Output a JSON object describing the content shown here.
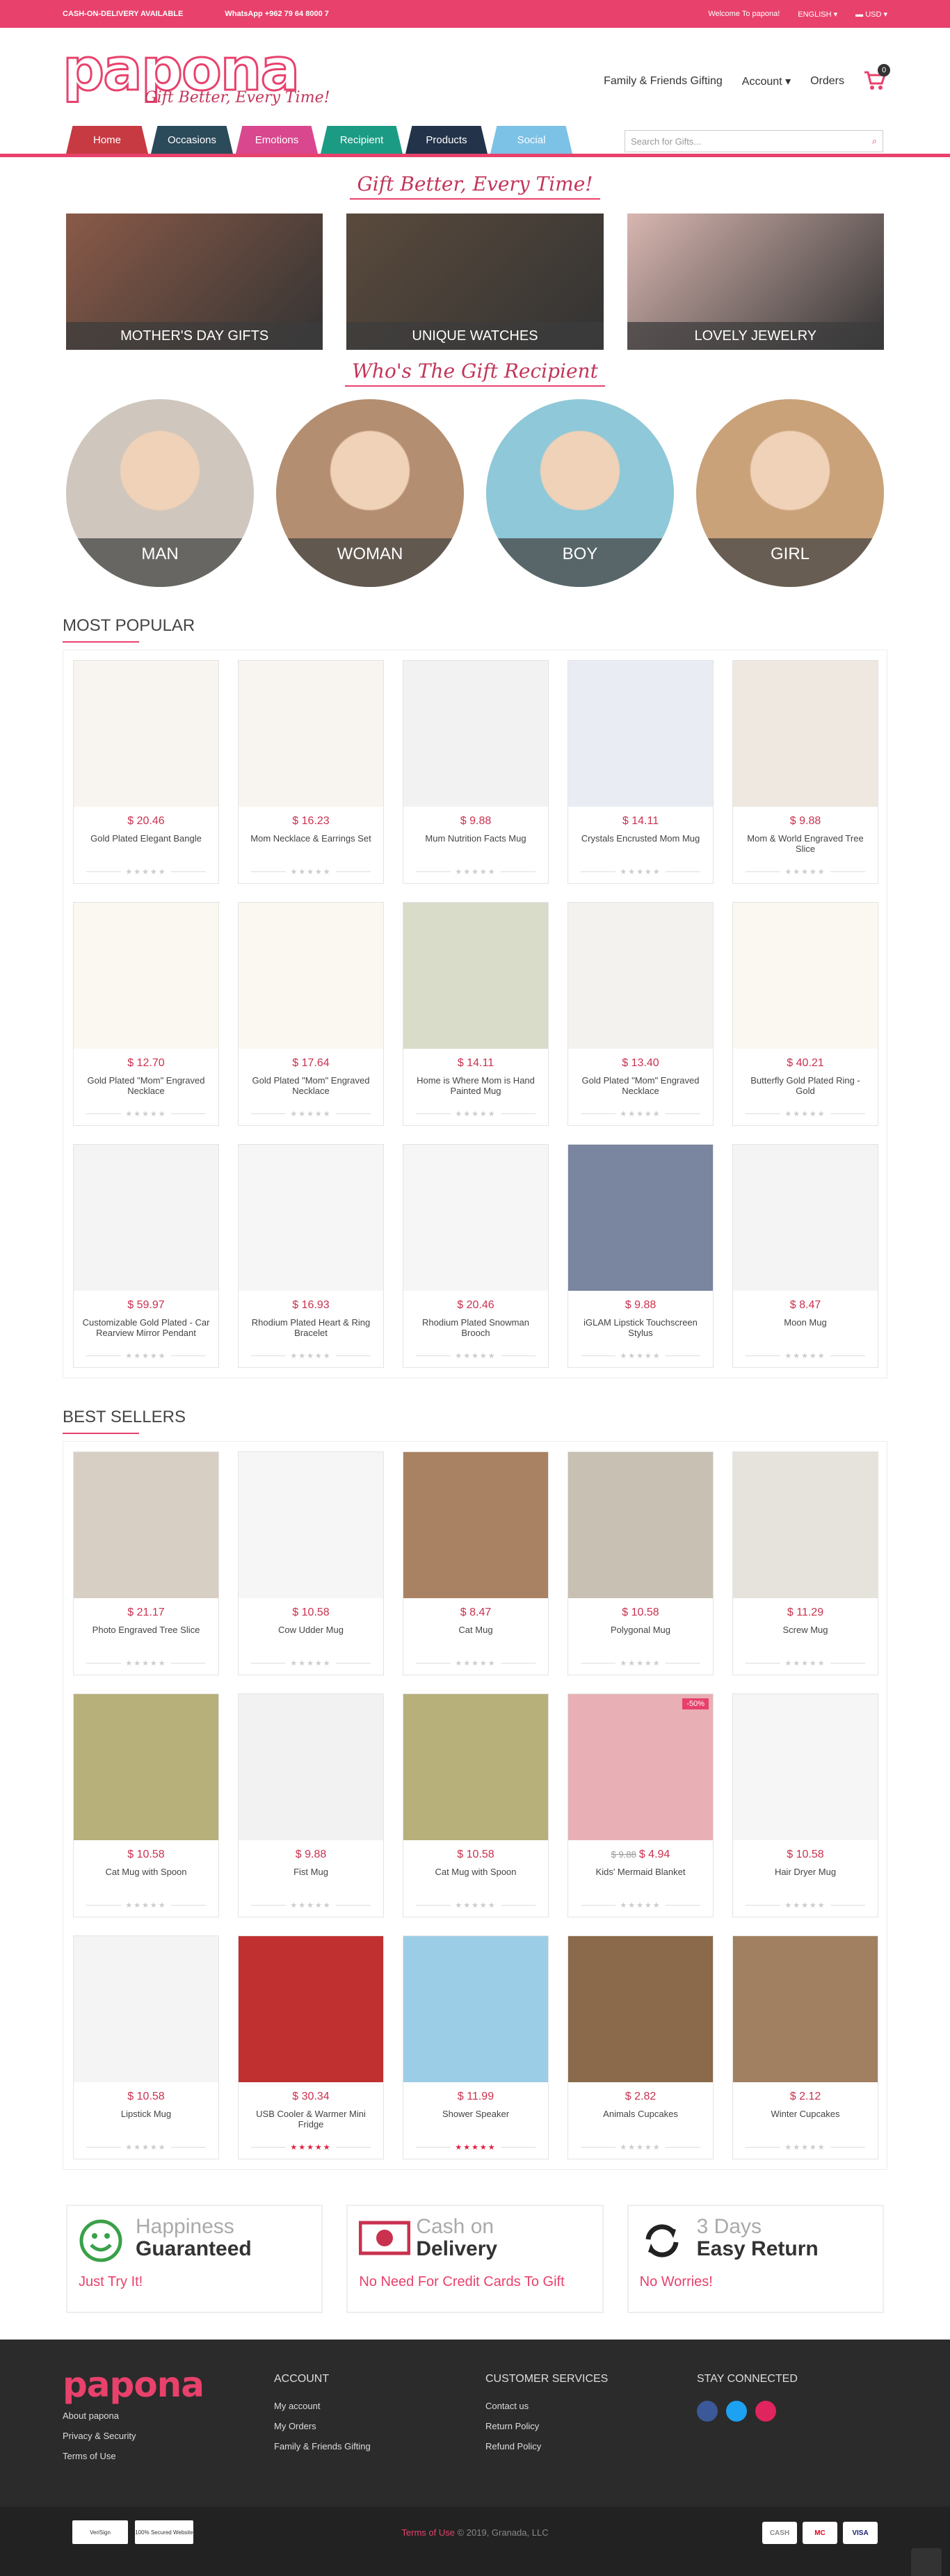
{
  "topbar": {
    "cod": "CASH-ON-DELIVERY AVAILABLE",
    "whatsapp": "WhatsApp +962 79 64 8000 7",
    "welcome": "Welcome To papona!",
    "language": "ENGLISH",
    "currency": "USD"
  },
  "header": {
    "logo": "papona",
    "tagline": "Gift Better, Every Time!",
    "nav": [
      "Family & Friends Gifting",
      "Account",
      "Orders"
    ],
    "cart_count": "0"
  },
  "tabs": [
    {
      "label": "Home",
      "color": "#c73a42"
    },
    {
      "label": "Occasions",
      "color": "#2b4a5a"
    },
    {
      "label": "Emotions",
      "color": "#d9478e"
    },
    {
      "label": "Recipient",
      "color": "#1c9b84"
    },
    {
      "label": "Products",
      "color": "#23334a"
    },
    {
      "label": "Social",
      "color": "#7cc1e6"
    }
  ],
  "search": {
    "placeholder": "Search for Gifts..."
  },
  "tagline1": "Gift Better, Every Time!",
  "banners": [
    {
      "label": "MOTHER'S DAY GIFTS",
      "bg": "#8a5a48"
    },
    {
      "label": "UNIQUE WATCHES",
      "bg": "#5a4a3c"
    },
    {
      "label": "LOVELY JEWELRY",
      "bg": "#d8b6b0"
    }
  ],
  "tagline2": "Who's The Gift Recipient",
  "recipients": [
    {
      "label": "MAN",
      "bg": "#cfc6bd"
    },
    {
      "label": "WOMAN",
      "bg": "#b48e70"
    },
    {
      "label": "BOY",
      "bg": "#8fc8d8"
    },
    {
      "label": "GIRL",
      "bg": "#c9a27a"
    }
  ],
  "popular": {
    "title": "MOST POPULAR",
    "items": [
      {
        "price": "$ 20.46",
        "name": "Gold Plated Elegant Bangle",
        "bg": "#f8f4ef"
      },
      {
        "price": "$ 16.23",
        "name": "Mom Necklace & Earrings Set",
        "bg": "#f8f4ef"
      },
      {
        "price": "$ 9.88",
        "name": "Mum Nutrition Facts Mug",
        "bg": "#f2f2f2"
      },
      {
        "price": "$ 14.11",
        "name": "Crystals Encrusted Mom Mug",
        "bg": "#e9edf3"
      },
      {
        "price": "$ 9.88",
        "name": "Mom & World Engraved Tree Slice",
        "bg": "#efe8e0"
      },
      {
        "price": "$ 12.70",
        "name": "Gold Plated \"Mom\" Engraved Necklace",
        "bg": "#fbf8f2"
      },
      {
        "price": "$ 17.64",
        "name": "Gold Plated \"Mom\" Engraved Necklace",
        "bg": "#fbf8f2"
      },
      {
        "price": "$ 14.11",
        "name": "Home is Where Mom is Hand Painted Mug",
        "bg": "#d9dcc8"
      },
      {
        "price": "$ 13.40",
        "name": "Gold Plated \"Mom\" Engraved Necklace",
        "bg": "#f4f2ee"
      },
      {
        "price": "$ 40.21",
        "name": "Butterfly Gold Plated Ring - Gold",
        "bg": "#fbf8f2"
      },
      {
        "price": "$ 59.97",
        "name": "Customizable Gold Plated - Car Rearview Mirror Pendant",
        "bg": "#f4f4f4"
      },
      {
        "price": "$ 16.93",
        "name": "Rhodium Plated Heart & Ring Bracelet",
        "bg": "#f6f6f6"
      },
      {
        "price": "$ 20.46",
        "name": "Rhodium Plated Snowman Brooch",
        "bg": "#f6f6f6"
      },
      {
        "price": "$ 9.88",
        "name": "iGLAM Lipstick Touchscreen Stylus",
        "bg": "#7a86a0"
      },
      {
        "price": "$ 8.47",
        "name": "Moon Mug",
        "bg": "#f4f4f4"
      }
    ]
  },
  "sellers": {
    "title": "BEST SELLERS",
    "items": [
      {
        "price": "$ 21.17",
        "name": "Photo Engraved Tree Slice",
        "bg": "#d8cfc4",
        "stars": "grey"
      },
      {
        "price": "$ 10.58",
        "name": "Cow Udder Mug",
        "bg": "#f6f6f6",
        "stars": "grey"
      },
      {
        "price": "$ 8.47",
        "name": "Cat Mug",
        "bg": "#a88262",
        "stars": "grey"
      },
      {
        "price": "$ 10.58",
        "name": "Polygonal Mug",
        "bg": "#c8c0b2",
        "stars": "grey"
      },
      {
        "price": "$ 11.29",
        "name": "Screw Mug",
        "bg": "#e6e2dc",
        "stars": "grey"
      },
      {
        "price": "$ 10.58",
        "name": "Cat Mug with Spoon",
        "bg": "#b8b07a",
        "stars": "grey"
      },
      {
        "price": "$ 9.88",
        "name": "Fist Mug",
        "bg": "#f2f2f2",
        "stars": "grey"
      },
      {
        "price": "$ 10.58",
        "name": "Cat Mug with Spoon",
        "bg": "#b8b07a",
        "stars": "grey"
      },
      {
        "price": "$ 4.94",
        "old_price": "$ 9.88",
        "name": "Kids' Mermaid Blanket",
        "bg": "#e8b0b4",
        "sale": "-50%",
        "stars": "grey"
      },
      {
        "price": "$ 10.58",
        "name": "Hair Dryer Mug",
        "bg": "#f6f6f6",
        "stars": "grey"
      },
      {
        "price": "$ 10.58",
        "name": "Lipstick Mug",
        "bg": "#f4f4f4",
        "stars": "grey"
      },
      {
        "price": "$ 30.34",
        "name": "USB Cooler & Warmer Mini Fridge",
        "bg": "#c03030",
        "stars": "red"
      },
      {
        "price": "$ 11.99",
        "name": "Shower Speaker",
        "bg": "#9ccde6",
        "stars": "red"
      },
      {
        "price": "$ 2.82",
        "name": "Animals Cupcakes",
        "bg": "#8a6a4a",
        "stars": "grey"
      },
      {
        "price": "$ 2.12",
        "name": "Winter Cupcakes",
        "bg": "#a08060",
        "stars": "grey"
      }
    ]
  },
  "features": [
    {
      "t1": "Happiness",
      "t2": "Guaranteed",
      "t3": "Just Try It!",
      "icon": "smiley-icon"
    },
    {
      "t1": "Cash on",
      "t2": "Delivery",
      "t3": "No Need For Credit Cards To Gift",
      "icon": "cash-icon"
    },
    {
      "t1": "3 Days",
      "t2": "Easy Return",
      "t3": "No Worries!",
      "icon": "return-icon"
    }
  ],
  "footer": {
    "logo": "papona",
    "links": [
      "About papona",
      "Privacy & Security",
      "Terms of Use"
    ],
    "account": {
      "title": "ACCOUNT",
      "links": [
        "My account",
        "My Orders",
        "Family & Friends Gifting"
      ]
    },
    "service": {
      "title": "CUSTOMER SERVICES",
      "links": [
        "Contact us",
        "Return Policy",
        "Refund Policy"
      ]
    },
    "social": {
      "title": "STAY CONNECTED"
    },
    "terms": "Terms of Use",
    "copyright": "© 2019, Granada, LLC",
    "badges": [
      "VeriSign",
      "100% Secured Website"
    ],
    "payments": [
      "CASH",
      "MC",
      "VISA"
    ]
  }
}
